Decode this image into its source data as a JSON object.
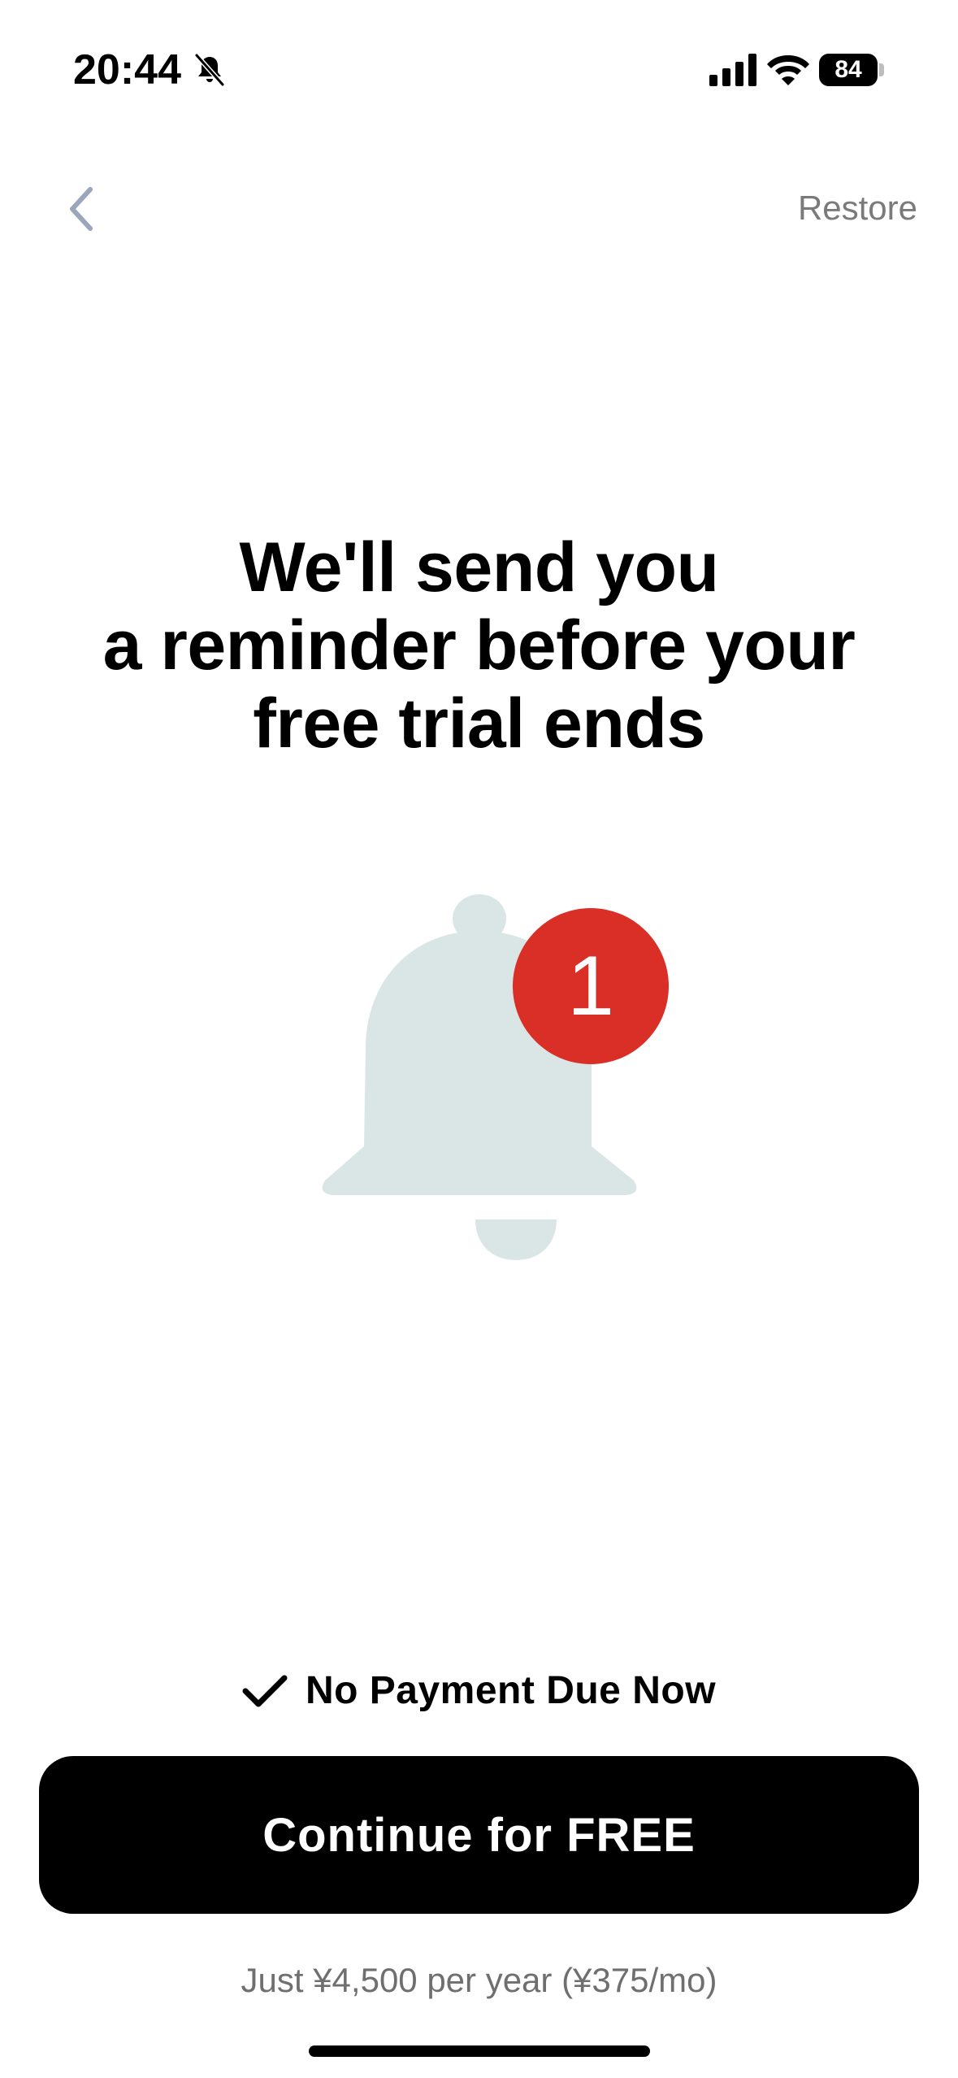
{
  "status_bar": {
    "time": "20:44",
    "battery": "84",
    "icons": [
      "bell-slash-icon",
      "cellular-signal-icon",
      "wifi-icon",
      "battery-icon"
    ]
  },
  "nav": {
    "back_icon": "chevron-left-icon",
    "restore_label": "Restore"
  },
  "headline": {
    "lines": [
      "We'll send you",
      "a reminder before your",
      "free trial ends"
    ]
  },
  "illustration": {
    "icon": "bell-icon",
    "badge_count": "1",
    "bell_color": "#dae6e6",
    "badge_color": "#da2f27"
  },
  "footer": {
    "check_icon": "checkmark-icon",
    "no_payment_text": "No Payment Due Now",
    "cta_label": "Continue for FREE",
    "price_note": "Just ¥4,500 per year (¥375/mo)"
  },
  "colors": {
    "accent": "#000000",
    "muted_text": "#7a7a7a",
    "back_chevron": "#9aa7bb"
  }
}
